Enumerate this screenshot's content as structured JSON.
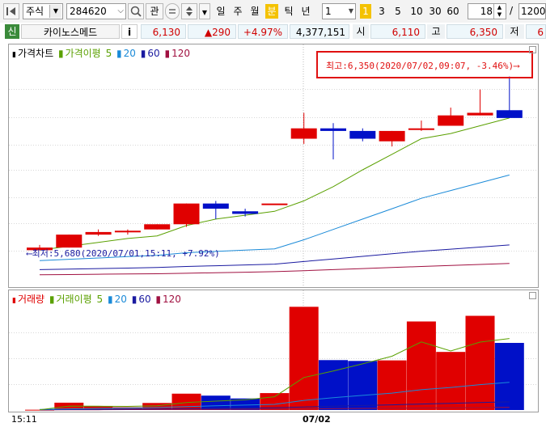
{
  "toolbar": {
    "market_type": "주식",
    "stock_code": "284620",
    "watch_label": "관",
    "period_buttons": [
      "일",
      "주",
      "월",
      "분",
      "틱",
      "년"
    ],
    "interval_value": "1",
    "interval_quick": [
      "1",
      "3",
      "5",
      "10",
      "30",
      "60"
    ],
    "count_value": "18",
    "count_sep": "/",
    "count_max": "1200"
  },
  "info": {
    "market_badge": "신",
    "stock_name": "카이노스메드",
    "info_button": "i",
    "price": "6,130",
    "change": "▲290",
    "change_rate": "+4.97%",
    "volume": "4,377,151",
    "open_label": "시",
    "open_value": "6,110",
    "high_label": "고",
    "high_value": "6,350",
    "low_label": "저",
    "low_value": "6"
  },
  "price_legend": {
    "name": "가격차트",
    "ma_name": "가격이평",
    "ma_periods": [
      "5",
      "20",
      "60",
      "120"
    ]
  },
  "volume_legend": {
    "name": "거래량",
    "ma_name": "거래이평",
    "ma_periods": [
      "5",
      "20",
      "60",
      "120"
    ]
  },
  "annotations": {
    "high_text": "최고:6,350(2020/07/02,09:07, -3.46%)⟶",
    "low_text": "⟵최저:5,680(2020/07/01,15:11, +7.92%)"
  },
  "x_axis": {
    "start_label": "15:11",
    "date_label": "07/02"
  },
  "colors": {
    "up": "#e00000",
    "down": "#0010c8",
    "ma5": "#5aa000",
    "ma20": "#1a8ad8",
    "ma60": "#1a1aa0",
    "ma120": "#a01040",
    "period_active": "#f4c200",
    "highlight": "#e01010"
  },
  "chart_data": {
    "type": "candlestick",
    "candles": [
      {
        "open": 5680,
        "high": 5700,
        "low": 5680,
        "close": 5690
      },
      {
        "open": 5690,
        "high": 5740,
        "low": 5690,
        "close": 5740
      },
      {
        "open": 5740,
        "high": 5760,
        "low": 5735,
        "close": 5750
      },
      {
        "open": 5750,
        "high": 5760,
        "low": 5740,
        "close": 5755
      },
      {
        "open": 5760,
        "high": 5780,
        "low": 5760,
        "close": 5780
      },
      {
        "open": 5780,
        "high": 5860,
        "low": 5770,
        "close": 5860
      },
      {
        "open": 5860,
        "high": 5870,
        "low": 5800,
        "close": 5840
      },
      {
        "open": 5830,
        "high": 5840,
        "low": 5810,
        "close": 5820
      },
      {
        "open": 5860,
        "high": 5860,
        "low": 5860,
        "close": 5860
      },
      {
        "open": 6110,
        "high": 6210,
        "low": 6090,
        "close": 6150
      },
      {
        "open": 6150,
        "high": 6170,
        "low": 6030,
        "close": 6140
      },
      {
        "open": 6140,
        "high": 6150,
        "low": 6100,
        "close": 6110
      },
      {
        "open": 6100,
        "high": 6140,
        "low": 6080,
        "close": 6140
      },
      {
        "open": 6150,
        "high": 6180,
        "low": 6140,
        "close": 6150
      },
      {
        "open": 6160,
        "high": 6230,
        "low": 6160,
        "close": 6200
      },
      {
        "open": 6200,
        "high": 6300,
        "low": 6200,
        "close": 6210
      },
      {
        "open": 6220,
        "high": 6350,
        "low": 6190,
        "close": 6190
      }
    ],
    "ma5": [
      5680,
      5695,
      5710,
      5725,
      5735,
      5775,
      5800,
      5815,
      5830,
      5870,
      5925,
      5990,
      6050,
      6110,
      6130,
      6160,
      6190
    ],
    "ma20": [
      5640,
      5645,
      5650,
      5655,
      5660,
      5670,
      5675,
      5680,
      5685,
      5720,
      5760,
      5800,
      5840,
      5880,
      5910,
      5940,
      5970
    ],
    "ma60": [
      5605,
      5607,
      5609,
      5611,
      5613,
      5617,
      5620,
      5623,
      5626,
      5636,
      5646,
      5656,
      5666,
      5676,
      5684,
      5692,
      5700
    ],
    "ma120": [
      5585,
      5586,
      5587,
      5588,
      5589,
      5591,
      5593,
      5595,
      5597,
      5601,
      5605,
      5609,
      5613,
      5617,
      5621,
      5625,
      5629
    ],
    "price_range": [
      5550,
      6380
    ],
    "volume": {
      "values": [
        5,
        130,
        70,
        50,
        125,
        290,
        255,
        205,
        300,
        1830,
        885,
        870,
        880,
        1570,
        1030,
        1670,
        1190
      ],
      "ma5": [
        5,
        70,
        68,
        64,
        76,
        133,
        158,
        181,
        235,
        576,
        693,
        818,
        953,
        1207,
        1047,
        1204,
        1268
      ],
      "ma20": [
        10,
        20,
        28,
        35,
        45,
        60,
        75,
        88,
        100,
        170,
        220,
        260,
        300,
        360,
        400,
        450,
        490
      ],
      "ma60": [
        5,
        8,
        12,
        15,
        18,
        24,
        30,
        35,
        40,
        55,
        68,
        80,
        92,
        106,
        118,
        132,
        145
      ],
      "ma120": [
        2,
        4,
        5,
        7,
        8,
        10,
        12,
        14,
        16,
        20,
        24,
        28,
        32,
        36,
        40,
        44,
        48
      ],
      "range": [
        0,
        1950
      ]
    }
  }
}
